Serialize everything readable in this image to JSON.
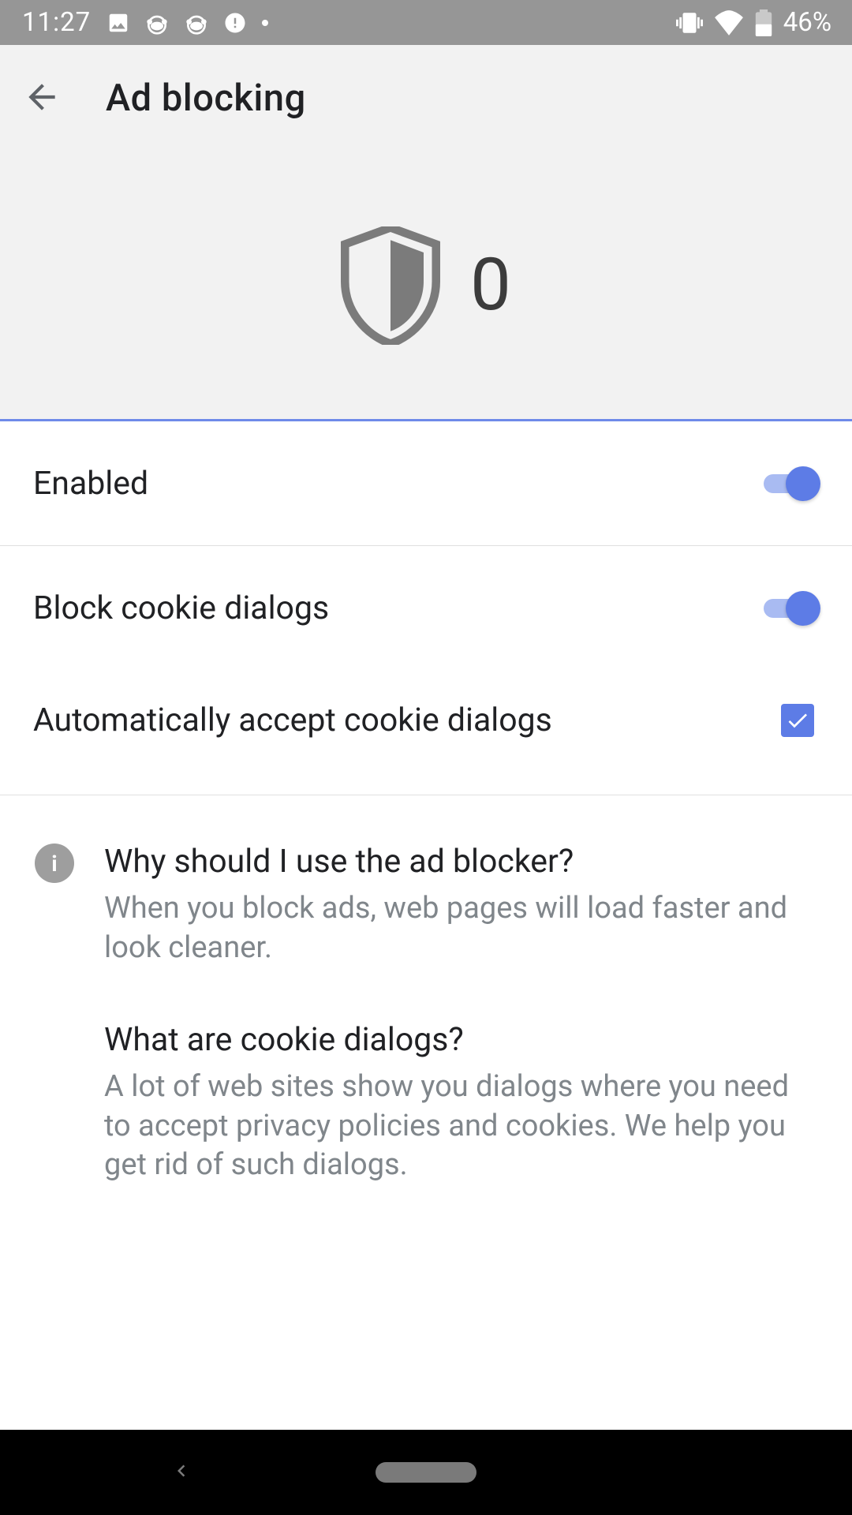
{
  "status": {
    "time": "11:27",
    "battery": "46%"
  },
  "header": {
    "title": "Ad blocking",
    "blocked_count": "0"
  },
  "settings": {
    "enabled": {
      "label": "Enabled",
      "on": true
    },
    "block_cookie": {
      "label": "Block cookie dialogs",
      "on": true
    },
    "auto_accept": {
      "label": "Automatically accept cookie dialogs",
      "checked": true
    }
  },
  "info": {
    "q1": {
      "heading": "Why should I use the ad blocker?",
      "body": "When you block ads, web pages will load faster and look cleaner."
    },
    "q2": {
      "heading": "What are cookie dialogs?",
      "body": "A lot of web sites show you dialogs where you need to accept privacy policies and cookies. We help you get rid of such dialogs."
    }
  }
}
